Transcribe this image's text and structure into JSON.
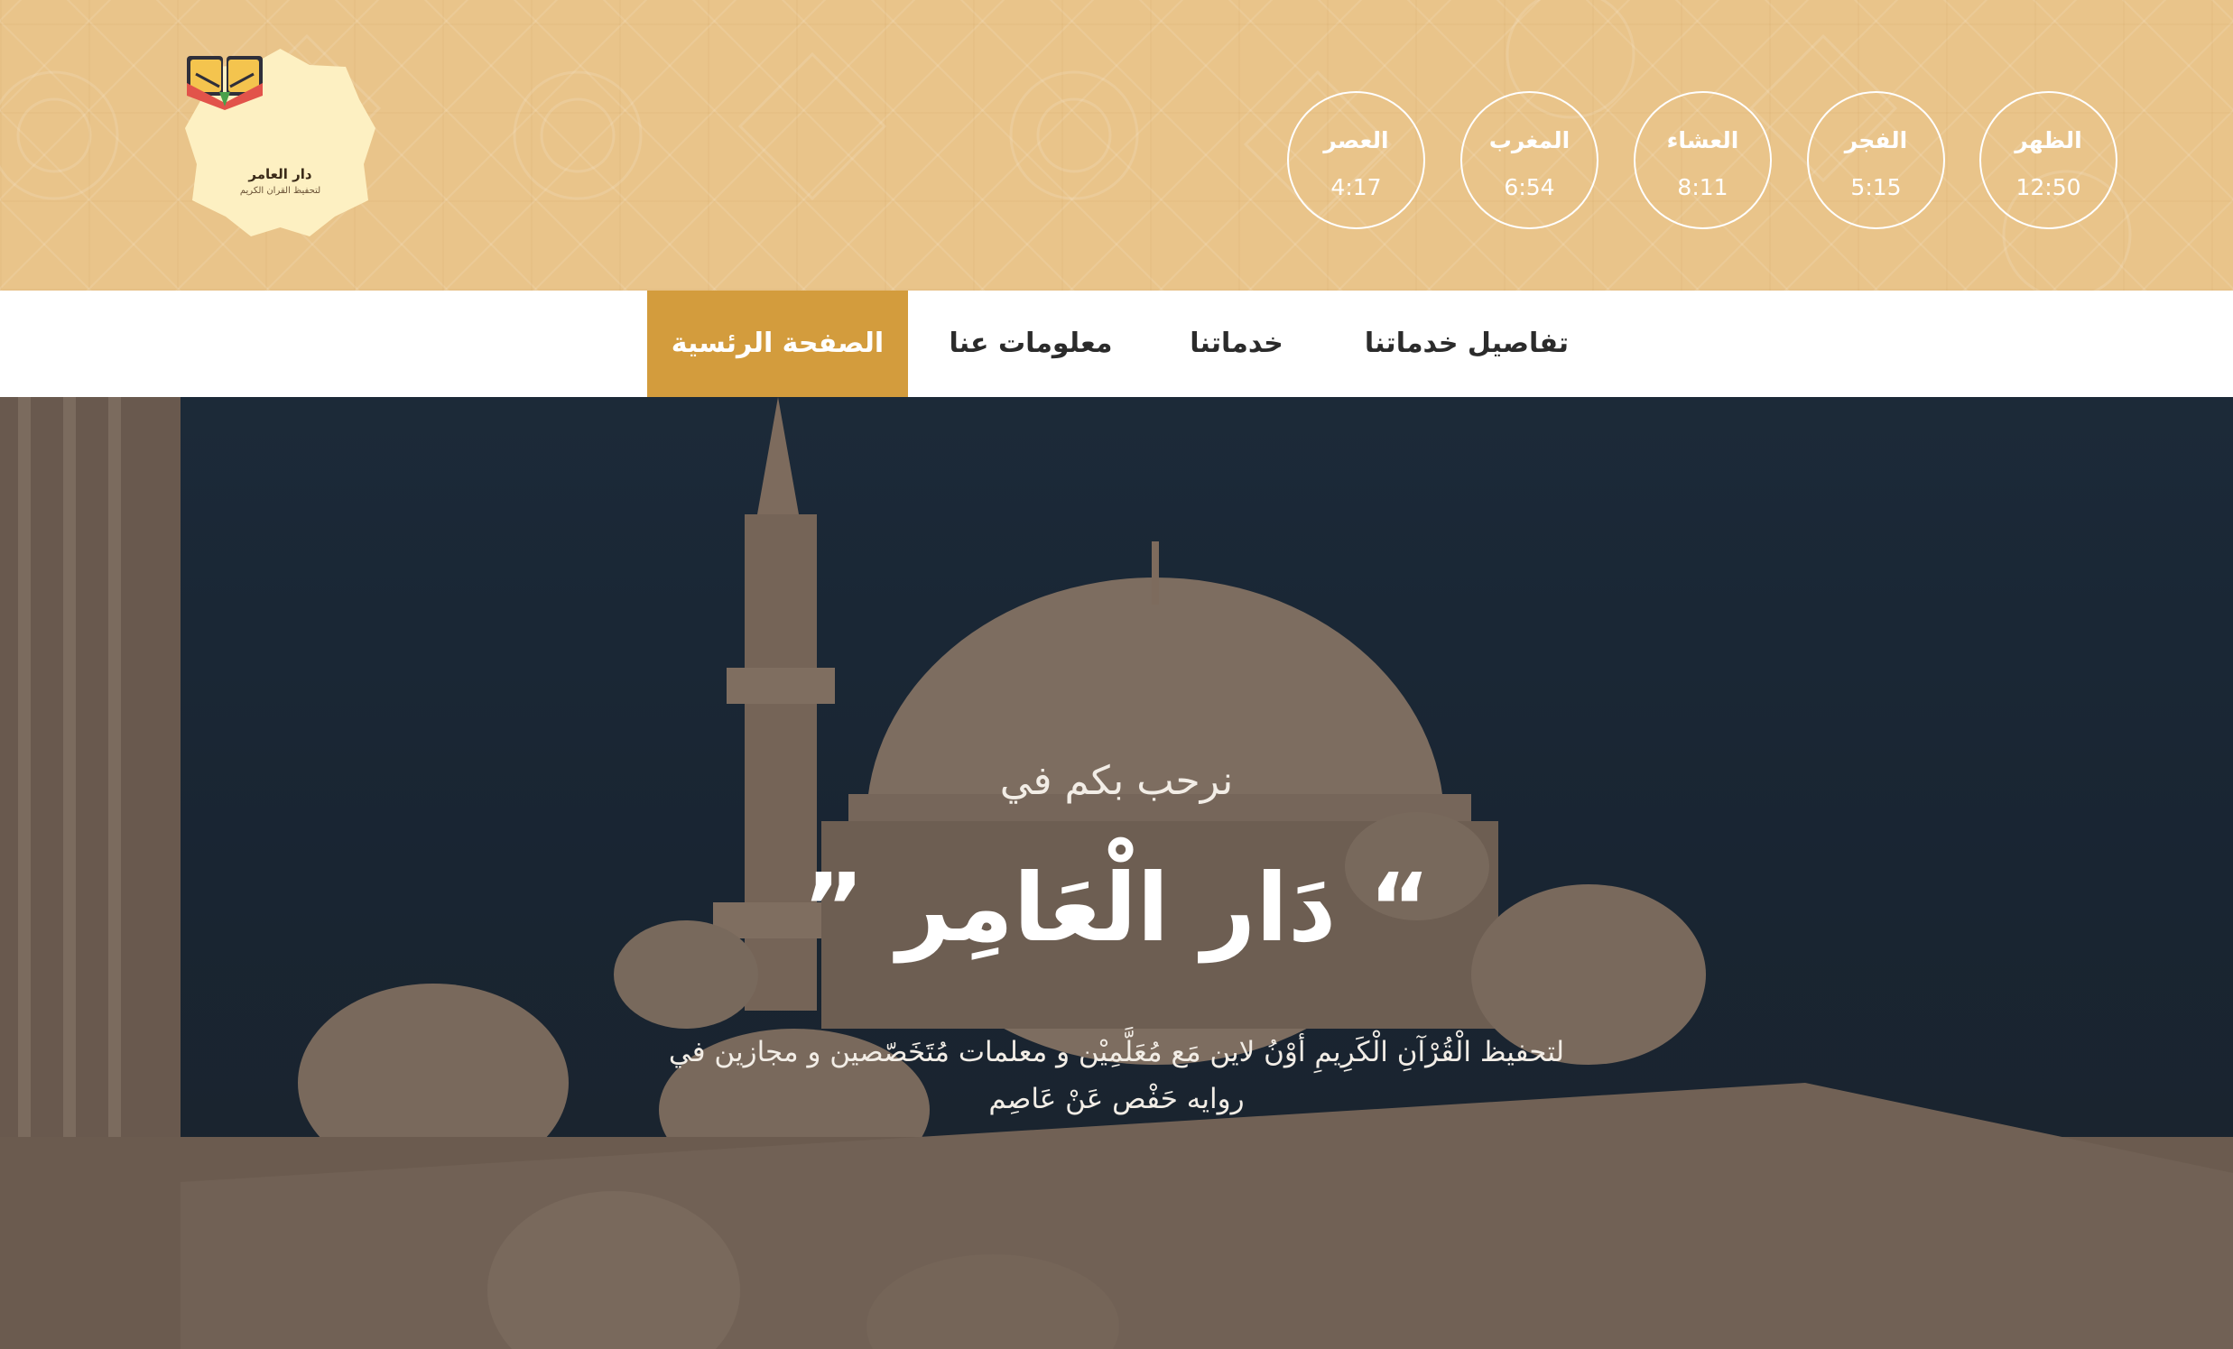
{
  "logo": {
    "name": "دار العامر",
    "tagline": "لتحفيظ القران الكريم",
    "icon": "open-book-icon"
  },
  "prayer_times": [
    {
      "name": "الظهر",
      "time": "12:50"
    },
    {
      "name": "الفجر",
      "time": "5:15"
    },
    {
      "name": "العشاء",
      "time": "8:11"
    },
    {
      "name": "المغرب",
      "time": "6:54"
    },
    {
      "name": "العصر",
      "time": "4:17"
    }
  ],
  "nav": {
    "items": [
      {
        "label": "الصفحة الرئسية",
        "active": true
      },
      {
        "label": "معلومات عنا",
        "active": false
      },
      {
        "label": "خدماتنا",
        "active": false
      },
      {
        "label": "تفاصيل خدماتنا",
        "active": false
      }
    ]
  },
  "hero": {
    "welcome": "نرحب بكم في",
    "title": "” دَار الْعَامِر “",
    "description": "لتحفيظ الْقُرْآنِ الْكَرِيمِ أوْنُ لاين مَع مُعَلَّمِيْن و معلمات مُتَخَصّصين و مجازين في روايه حَفْص عَنْ عَاصِم"
  },
  "colors": {
    "header_bg": "#e9c48a",
    "accent": "#d39c3d",
    "logo_bg": "#fdf0c2",
    "hero_sky": "#1f3245"
  }
}
